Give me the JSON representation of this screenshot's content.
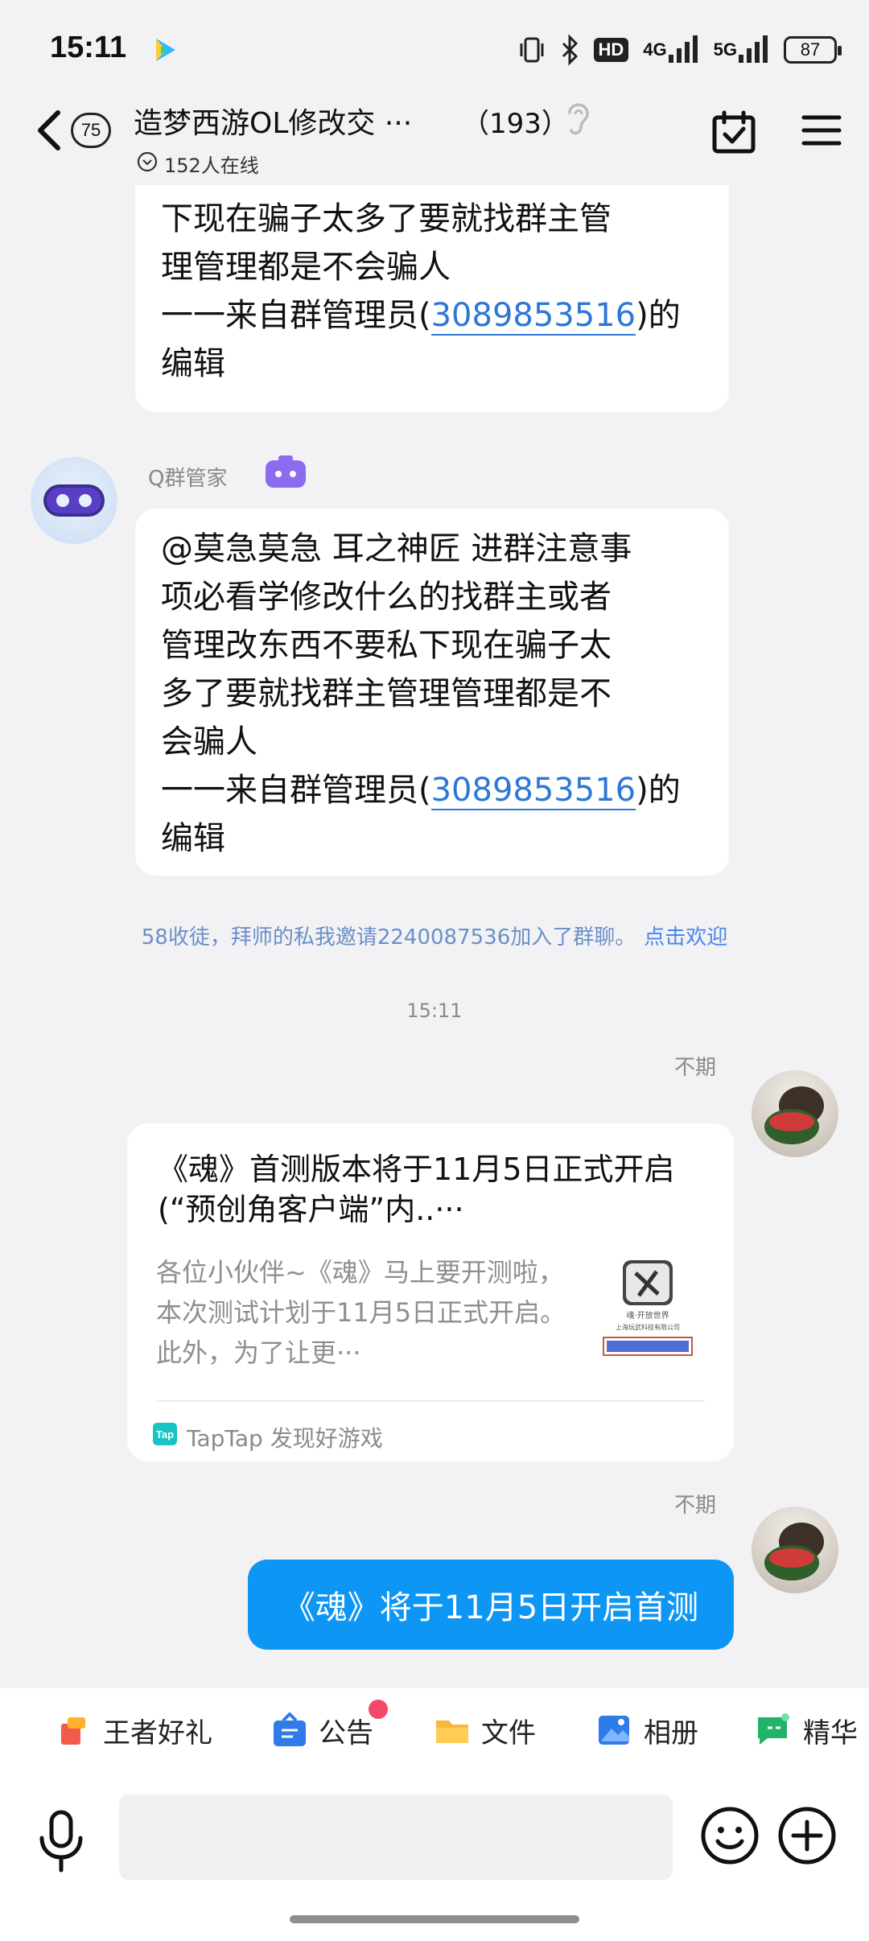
{
  "status_bar": {
    "time": "15:11",
    "network_label": "4G",
    "network2_label": "5G",
    "hd_label": "HD",
    "battery": "87"
  },
  "header": {
    "unread_count": "75",
    "group_name": "造梦西游OL修改交 ···",
    "member_count": "（193）",
    "online_text": "152人在线"
  },
  "messages": {
    "partial": {
      "lines": [
        "下现在骗子太多了要就找群主管",
        "理管理都是不会骗人"
      ],
      "footer_prefix": "一一来自群管理员(",
      "footer_id": "3089853516",
      "footer_suffix": ")的",
      "footer_last": "编辑"
    },
    "bot": {
      "sender": "Q群管家",
      "lines": [
        "@莫急莫急 耳之神匠 进群注意事",
        "项必看学修改什么的找群主或者",
        "管理改东西不要私下现在骗子太",
        "多了要就找群主管理管理都是不",
        "会骗人"
      ],
      "footer_prefix": "一一来自群管理员(",
      "footer_id": "3089853516",
      "footer_suffix": ")的",
      "footer_last": "编辑"
    },
    "system": {
      "text": "58收徒，拜师的私我邀请2240087536加入了群聊。",
      "action": "点击欢迎"
    },
    "time_separator": "15:11",
    "card_msg": {
      "sender": "不期",
      "title": "《魂》首测版本将于11月5日正式开启(“预创角客户端”内..···",
      "description": "各位小伙伴~《魂》马上要开测啦，本次测试计划于11月5日正式开启。此外，为了让更···",
      "thumb_line1": "魂·开放世界",
      "thumb_line2": "上海玩武科技有限公司",
      "source_icon": "Tap",
      "source": "TapTap 发现好游戏"
    },
    "text_msg": {
      "sender": "不期",
      "text": "《魂》将于11月5日开启首测"
    }
  },
  "quick_tools": [
    {
      "label": "王者好礼",
      "icon": "gift-icon"
    },
    {
      "label": "公告",
      "icon": "announcement-icon"
    },
    {
      "label": "文件",
      "icon": "folder-icon"
    },
    {
      "label": "相册",
      "icon": "album-icon"
    },
    {
      "label": "精华",
      "icon": "essence-icon"
    }
  ],
  "input": {
    "placeholder": ""
  },
  "colors": {
    "accent_blue": "#0e96f5",
    "link_blue": "#2d77d6",
    "badge_red": "#f44868",
    "background": "#f2f2f4"
  }
}
